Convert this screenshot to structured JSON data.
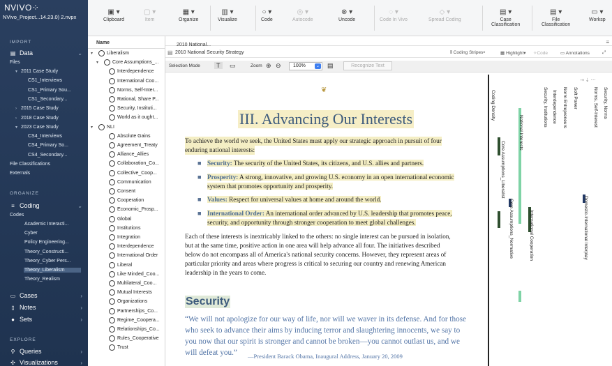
{
  "app": {
    "logo": "NVIVO⁘",
    "project": "NVivo_Project...14.23.0) 2.nvpx"
  },
  "sidebar": {
    "import_head": "IMPORT",
    "data_label": "Data",
    "files_label": "Files",
    "tree": [
      {
        "label": "2011 Case Study",
        "indent": 1,
        "caret": "▾"
      },
      {
        "label": "CS1_Interviews",
        "indent": 2
      },
      {
        "label": "CS1_Primary Sou...",
        "indent": 2
      },
      {
        "label": "CS1_Secondary...",
        "indent": 2
      },
      {
        "label": "2015 Case Study",
        "indent": 1,
        "caret": "›"
      },
      {
        "label": "2018 Case Study",
        "indent": 1,
        "caret": "›"
      },
      {
        "label": "2023 Case Study",
        "indent": 1,
        "caret": "▾"
      },
      {
        "label": "CS4_Interviews",
        "indent": 2
      },
      {
        "label": "CS4_Primary So...",
        "indent": 2
      },
      {
        "label": "CS4_Secondary...",
        "indent": 2
      },
      {
        "label": "File Classifications",
        "indent": 0
      },
      {
        "label": "Externals",
        "indent": 0
      }
    ],
    "organize_head": "ORGANIZE",
    "coding_label": "Coding",
    "codes_label": "Codes",
    "codes": [
      "Academic Interacti...",
      "Cyber",
      "Policy Engineering...",
      "Theory_Constructi...",
      "Theory_Cyber Pers...",
      "Theory_Liberalism",
      "Theory_Realism"
    ],
    "selected_code": "Theory_Liberalism",
    "cases_label": "Cases",
    "notes_label": "Notes",
    "sets_label": "Sets",
    "explore_head": "EXPLORE",
    "queries_label": "Queries",
    "visualizations_label": "Visualizations"
  },
  "ribbon": [
    {
      "label": "Clipboard",
      "icon": "clipboard-icon",
      "glyph": "▣",
      "enabled": true
    },
    {
      "label": "Item",
      "icon": "item-icon",
      "glyph": "▢",
      "enabled": false
    },
    {
      "label": "Organize",
      "icon": "organize-icon",
      "glyph": "▦",
      "enabled": true
    },
    {
      "label": "Visualize",
      "icon": "visualize-icon",
      "glyph": "▥",
      "enabled": true
    },
    {
      "label": "Code",
      "icon": "code-icon",
      "glyph": "○",
      "enabled": true
    },
    {
      "label": "Autocode",
      "icon": "autocode-icon",
      "glyph": "◎",
      "enabled": false
    },
    {
      "label": "Uncode",
      "icon": "uncode-icon",
      "glyph": "⊗",
      "enabled": true
    },
    {
      "label": "Code In Vivo",
      "icon": "code-in-vivo-icon",
      "glyph": "◌",
      "enabled": false
    },
    {
      "label": "Spread Coding",
      "icon": "spread-coding-icon",
      "glyph": "◇",
      "enabled": false
    },
    {
      "label": "Case\nClassification",
      "icon": "case-classification-icon",
      "glyph": "▤",
      "enabled": true
    },
    {
      "label": "File\nClassification",
      "icon": "file-classification-icon",
      "glyph": "▤",
      "enabled": true
    },
    {
      "label": "Worksp",
      "icon": "workspace-icon",
      "glyph": "▭",
      "enabled": true
    }
  ],
  "nodes": {
    "header": "Name",
    "items": [
      {
        "label": "Liberalism",
        "level": 0,
        "caret": "▾"
      },
      {
        "label": "Core Assumptions_...",
        "level": 1,
        "caret": "▾"
      },
      {
        "label": "Interdependence",
        "level": 2
      },
      {
        "label": "International Coo...",
        "level": 2
      },
      {
        "label": "Norms, Self-Inter...",
        "level": 2
      },
      {
        "label": "Rational, Share P...",
        "level": 2
      },
      {
        "label": "Security, Instituti...",
        "level": 2
      },
      {
        "label": "World as it ought...",
        "level": 2
      },
      {
        "label": "NLI",
        "level": 0,
        "caret": "▾"
      },
      {
        "label": "Absolute Gains",
        "level": 2
      },
      {
        "label": "Agreement_Treaty",
        "level": 2
      },
      {
        "label": "Alliance_Allies",
        "level": 2
      },
      {
        "label": "Collaboration_Co...",
        "level": 2
      },
      {
        "label": "Collective_Coop...",
        "level": 2
      },
      {
        "label": "Communication",
        "level": 2
      },
      {
        "label": "Consent",
        "level": 2
      },
      {
        "label": "Cooperation",
        "level": 2
      },
      {
        "label": "Economic_Prosp...",
        "level": 2
      },
      {
        "label": "Global",
        "level": 2
      },
      {
        "label": "Institutions",
        "level": 2
      },
      {
        "label": "Integration",
        "level": 2
      },
      {
        "label": "Interdependence",
        "level": 2
      },
      {
        "label": "International Order",
        "level": 2
      },
      {
        "label": "Liberal",
        "level": 2
      },
      {
        "label": "Like Minded_Coo...",
        "level": 2
      },
      {
        "label": "Multilateral_Coo...",
        "level": 2
      },
      {
        "label": "Mutual Interests",
        "level": 2
      },
      {
        "label": "Organizations",
        "level": 2
      },
      {
        "label": "Partnerships_Co...",
        "level": 2
      },
      {
        "label": "Regime_Coopera...",
        "level": 2
      },
      {
        "label": "Relationships_Co...",
        "level": 2
      },
      {
        "label": "Rules_Cooperative",
        "level": 2
      },
      {
        "label": "Trust",
        "level": 2
      }
    ]
  },
  "doc": {
    "tab": "2010 National...",
    "title": "2010 National Security Strategy",
    "coding_stripes": "Coding Stripes▾",
    "highlight": "Highlight▾",
    "code": "Code",
    "annotations": "Annotations",
    "selection_mode": "Selection Mode",
    "zoom_label": "Zoom",
    "zoom_value": "100%",
    "recognize_text": "Recognize Text",
    "heading": "III. Advancing Our Interests",
    "intro_1": "To achieve the world we seek, the United States must apply our strategic approach in pursuit of four",
    "intro_2": "enduring national interests:",
    "bullets": [
      {
        "term": "Security:",
        "line1": " The security of the United States, its citizens, and U.S. allies and partners.",
        "line2": ""
      },
      {
        "term": "Prosperity:",
        "line1": " A strong, innovative, and growing U.S. economy in an open international economic",
        "line2": "system that promotes opportunity and prosperity."
      },
      {
        "term": "Values:",
        "line1": " Respect for universal values at home and around the world.",
        "line2": ""
      },
      {
        "term": "International Order:",
        "line1": " An international order advanced by U.S. leadership that promotes peace,",
        "line2": "security, and opportunity through stronger cooperation to meet global challenges."
      }
    ],
    "body_lines": [
      "Each of these interests is inextricably linked to the others: no single interest can be pursued in isolation,",
      "but at the same time, positive action in one area will help advance all four. The initiatives described",
      "below do not encompass all of America's national security concerns. However, they represent areas of",
      "particular priority and areas where progress is critical to securing our country and renewing American",
      "leadership in the years to come."
    ],
    "security_heading": "Security",
    "quote_lines": [
      "“We will not apologize for our way of life, nor will we waver in its defense. And for those",
      "who seek to advance their aims by inducing terror and slaughtering innocents, we say to",
      "you now that our spirit is stronger and cannot be broken—you cannot outlast us, and we",
      "will defeat you.”"
    ],
    "attribution": "—President Barack Obama, Inaugural Address, January 20, 2009"
  },
  "stripes": {
    "labels": [
      "Coding Density",
      "Core Assumptions_Liberalist",
      "National Interests",
      "Core Assumptions_Normative",
      "International Cooperation",
      "Security, Institutions",
      "Interdependence",
      "Norm Entrepreneurs",
      "Soft Power",
      "Domestic-International Interplay",
      "Norms, Self-Interest",
      "Security, Norms"
    ],
    "colors": {
      "density": "#2f4f2f",
      "green": "#7fd3a6",
      "navy": "#233a66"
    }
  }
}
